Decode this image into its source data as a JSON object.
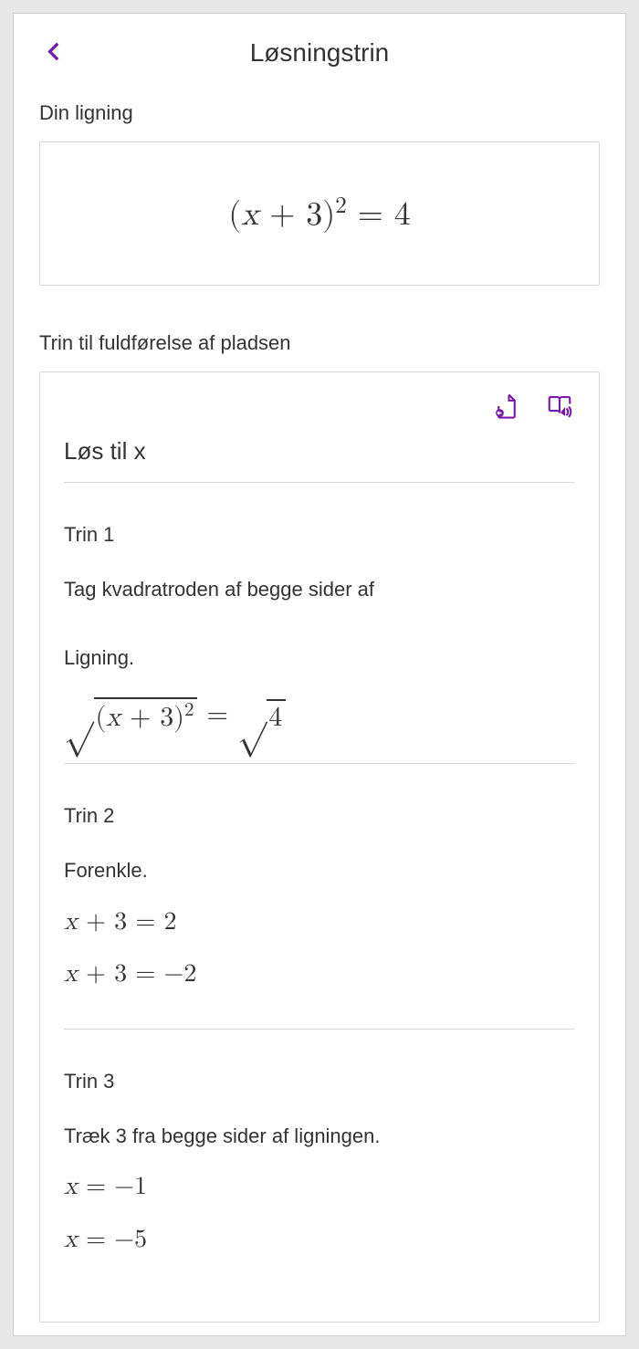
{
  "header": {
    "title": "Løsningstrin"
  },
  "equation": {
    "label": "Din ligning",
    "display": "(x + 3)² = 4"
  },
  "solution": {
    "label": "Trin til fuldførelse af pladsen",
    "title": "Løs til x",
    "icons": {
      "insert": "insert-to-page-icon",
      "reader": "immersive-reader-icon"
    },
    "steps": [
      {
        "label": "Trin 1",
        "description_line1": "Tag kvadratroden af begge sider af",
        "description_line2": "Ligning.",
        "math": [
          "√((x + 3)²) = √4"
        ]
      },
      {
        "label": "Trin 2",
        "description_line1": "Forenkle.",
        "math": [
          "x + 3 = 2",
          "x + 3 = −2"
        ]
      },
      {
        "label": "Trin 3",
        "description_line1": "Træk 3 fra begge sider af ligningen.",
        "math": [
          "x = −1",
          "x = −5"
        ]
      }
    ]
  }
}
